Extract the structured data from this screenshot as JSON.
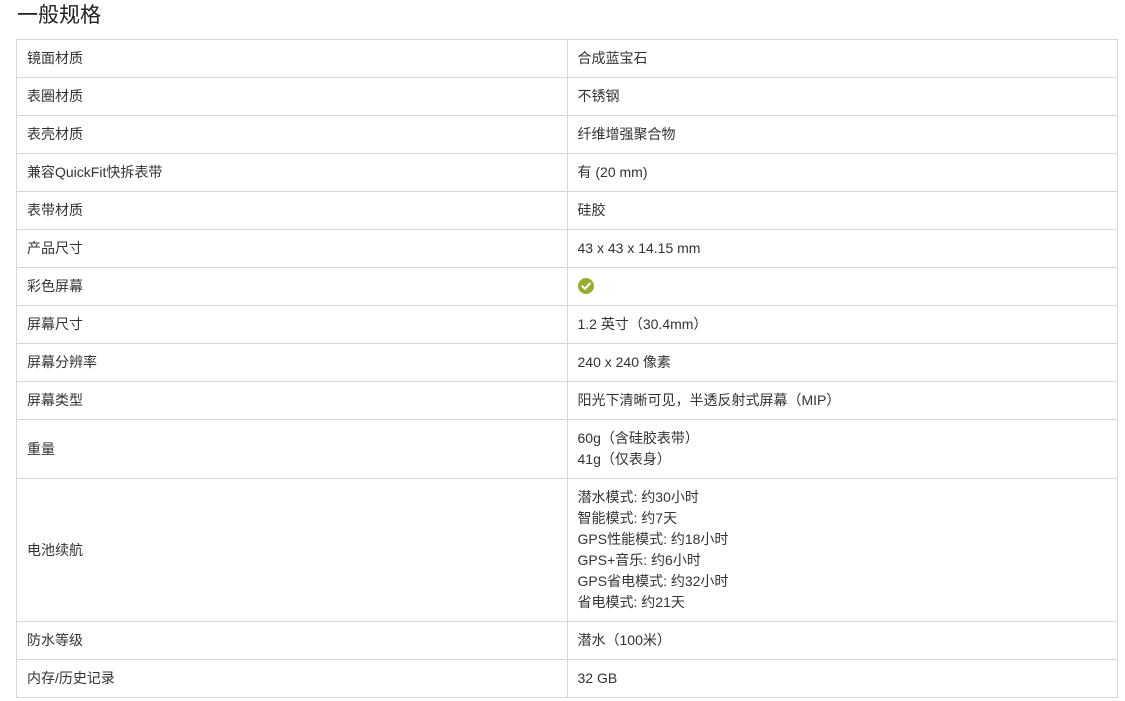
{
  "page": {
    "title": "一般规格"
  },
  "colors": {
    "check_icon": "#9aac2f",
    "border": "#d6d6d6"
  },
  "specs": [
    {
      "label": "镜面材质",
      "value": "合成蓝宝石"
    },
    {
      "label": "表圈材质",
      "value": "不锈钢"
    },
    {
      "label": "表壳材质",
      "value": "纤维增强聚合物"
    },
    {
      "label": "兼容QuickFit快拆表带",
      "value": "有 (20 mm)"
    },
    {
      "label": "表带材质",
      "value": "硅胶"
    },
    {
      "label": "产品尺寸",
      "value": "43 x 43 x 14.15 mm"
    },
    {
      "label": "彩色屏幕",
      "icon": "check-circle-icon"
    },
    {
      "label": "屏幕尺寸",
      "value": "1.2 英寸（30.4mm）"
    },
    {
      "label": "屏幕分辨率",
      "value": "240 x 240 像素"
    },
    {
      "label": "屏幕类型",
      "value": "阳光下清晰可见，半透反射式屏幕（MIP）"
    },
    {
      "label": "重量",
      "lines": [
        "60g（含硅胶表带）",
        "41g（仅表身）"
      ]
    },
    {
      "label": "电池续航",
      "lines": [
        "潜水模式: 约30小时",
        "智能模式: 约7天",
        "GPS性能模式: 约18小时",
        "GPS+音乐: 约6小时",
        "GPS省电模式: 约32小时",
        "省电模式: 约21天"
      ]
    },
    {
      "label": "防水等级",
      "value": "潜水（100米）"
    },
    {
      "label": "内存/历史记录",
      "value": "32 GB"
    }
  ]
}
